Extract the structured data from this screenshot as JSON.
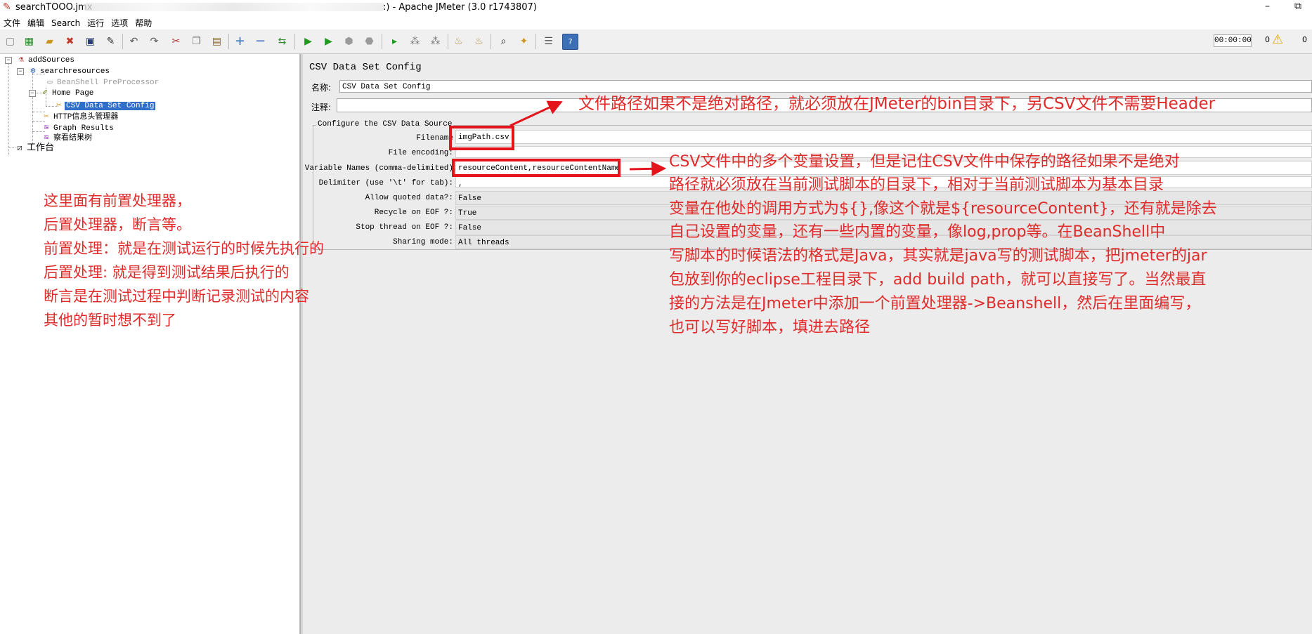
{
  "window": {
    "title_prefix": "searchTOOO.jmx",
    "title_suffix": ":) - Apache JMeter (3.0 r1743807)",
    "maximize_glyph": "–",
    "restore_glyph": "⧉"
  },
  "menu": [
    "文件",
    "编辑",
    "Search",
    "运行",
    "选项",
    "帮助"
  ],
  "toolbar": {
    "timer": "00:00:00",
    "error_count": "0",
    "thread_count": "0"
  },
  "tree": {
    "nodes": [
      {
        "label": "addSources",
        "state": "normal"
      },
      {
        "label": "searchresources",
        "state": "normal"
      },
      {
        "label": "BeanShell PreProcessor",
        "state": "disabled"
      },
      {
        "label": "Home Page",
        "state": "normal"
      },
      {
        "label": "CSV Data Set Config",
        "state": "selected"
      },
      {
        "label": "HTTP信息头管理器",
        "state": "normal"
      },
      {
        "label": "Graph Results",
        "state": "normal"
      },
      {
        "label": "察看结果树",
        "state": "normal"
      },
      {
        "label": "工作台",
        "state": "normal"
      }
    ]
  },
  "panel": {
    "heading": "CSV Data Set Config",
    "name_label": "名称:",
    "name_value": "CSV Data Set Config",
    "comment_label": "注释:",
    "comment_value": "",
    "group_title": "Configure the CSV Data Source",
    "rows": [
      {
        "label": "Filename",
        "value": "imgPath.csv"
      },
      {
        "label": "File encoding:",
        "value": ""
      },
      {
        "label": "Variable Names (comma-delimited)",
        "value": "resourceContent,resourceContentName"
      },
      {
        "label": "Delimiter (use '\\t' for tab):",
        "value": ","
      },
      {
        "label": "Allow quoted data?:",
        "value": "False"
      },
      {
        "label": "Recycle on EOF ?:",
        "value": "True"
      },
      {
        "label": "Stop thread on EOF ?:",
        "value": "False"
      },
      {
        "label": "Sharing mode:",
        "value": "All threads"
      }
    ]
  },
  "annotations": {
    "filename_note": "文件路径如果不是绝对路径，就必须放在JMeter的bin目录下，另CSV文件不需要Header",
    "variables_note": [
      "CSV文件中的多个变量设置，但是记住CSV文件中保存的路径如果不是绝对",
      "路径就必须放在当前测试脚本的目录下，相对于当前测试脚本为基本目录",
      "变量在他处的调用方式为${},像这个就是${resourceContent}，还有就是除去",
      "自己设置的变量，还有一些内置的变量，像log,prop等。在BeanShell中",
      "写脚本的时候语法的格式是Java，其实就是java写的测试脚本，把jmeter的jar",
      "包放到你的eclipse工程目录下，add build path，就可以直接写了。当然最直",
      "接的方法是在Jmeter中添加一个前置处理器->Beanshell，然后在里面编写，",
      "也可以写好脚本，填进去路径"
    ],
    "left_note": [
      "这里面有前置处理器，",
      "后置处理器，断言等。",
      "前置处理：就是在测试运行的时候先执行的",
      "后置处理: 就是得到测试结果后执行的",
      "断言是在测试过程中判断记录测试的内容",
      "其他的暂时想不到了"
    ],
    "accent_color": "#e3141b"
  }
}
